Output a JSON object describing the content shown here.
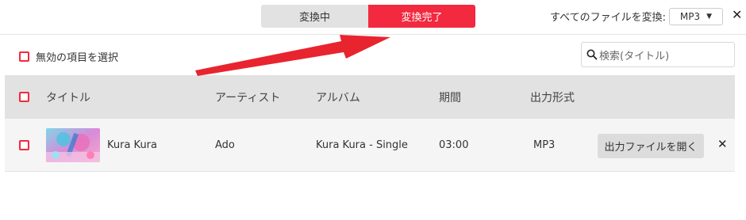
{
  "tabs": [
    {
      "label": "変換中",
      "active": false
    },
    {
      "label": "変換完了",
      "active": true
    }
  ],
  "convert_all": {
    "label": "すべてのファイルを変換:",
    "format": "MP3"
  },
  "select_invalid": {
    "label": "無効の項目を選択"
  },
  "search": {
    "placeholder": "検索(タイトル)"
  },
  "table": {
    "headers": {
      "title": "タイトル",
      "artist": "アーティスト",
      "album": "アルバム",
      "duration": "期間",
      "format": "出力形式"
    },
    "rows": [
      {
        "title": "Kura Kura",
        "artist": "Ado",
        "album": "Kura Kura - Single",
        "duration": "03:00",
        "format": "MP3",
        "open_label": "出力ファイルを開く"
      }
    ]
  },
  "colors": {
    "accent": "#f2293f",
    "header_bg": "#e2e2e2",
    "row_bg": "#f5f5f5"
  },
  "icons": {
    "search": "magnifier-icon",
    "close": "close-icon",
    "dropdown": "caret-down-icon",
    "annotation": "red-arrow"
  }
}
